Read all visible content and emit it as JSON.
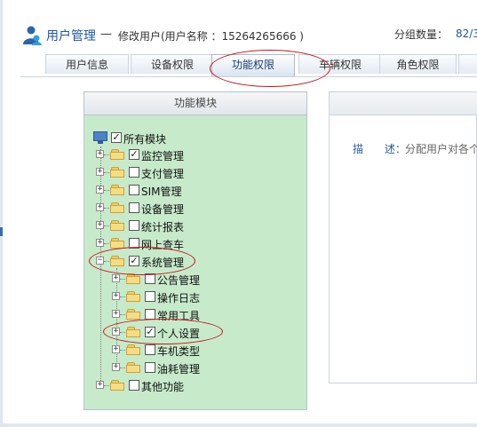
{
  "header": {
    "title": "用户管理",
    "separator": "—",
    "subtitle": "修改用户(用户名称 ：15264265666 )",
    "group_count_label": "分组数量：",
    "group_count_value": "82/3"
  },
  "tabs": [
    {
      "label": "用户信息",
      "active": false
    },
    {
      "label": "设备权限",
      "active": false
    },
    {
      "label": "功能权限",
      "active": true
    },
    {
      "label": "车辆权限",
      "active": false
    },
    {
      "label": "角色权限",
      "active": false
    },
    {
      "label": "",
      "active": false
    }
  ],
  "module_panel": {
    "header": "功能模块",
    "root": {
      "label": "所有模块",
      "checked": true
    },
    "items": [
      {
        "label": "监控管理",
        "checked": true,
        "expanded": false
      },
      {
        "label": "支付管理",
        "checked": false,
        "expanded": false
      },
      {
        "label": "SIM管理",
        "checked": false,
        "expanded": false
      },
      {
        "label": "设备管理",
        "checked": false,
        "expanded": false
      },
      {
        "label": "统计报表",
        "checked": false,
        "expanded": false
      },
      {
        "label": "网上查车",
        "checked": false,
        "expanded": false
      },
      {
        "label": "系统管理",
        "checked": true,
        "expanded": true,
        "children": [
          {
            "label": "公告管理",
            "checked": false
          },
          {
            "label": "操作日志",
            "checked": false
          },
          {
            "label": "常用工具",
            "checked": false
          },
          {
            "label": "个人设置",
            "checked": true
          },
          {
            "label": "车机类型",
            "checked": false
          },
          {
            "label": "油耗管理",
            "checked": false
          }
        ]
      },
      {
        "label": "其他功能",
        "checked": false,
        "expanded": false
      }
    ]
  },
  "detail_panel": {
    "desc_label": "描 述：",
    "desc_value": "分配用户对各个"
  },
  "colors": {
    "accent": "#1f57a0",
    "panel_bg": "#c7eacb",
    "highlight_ellipse": "#c4161c"
  },
  "icons": {
    "logo": "user-group-icon",
    "root": "monitor-icon",
    "node": "folder-icon"
  }
}
